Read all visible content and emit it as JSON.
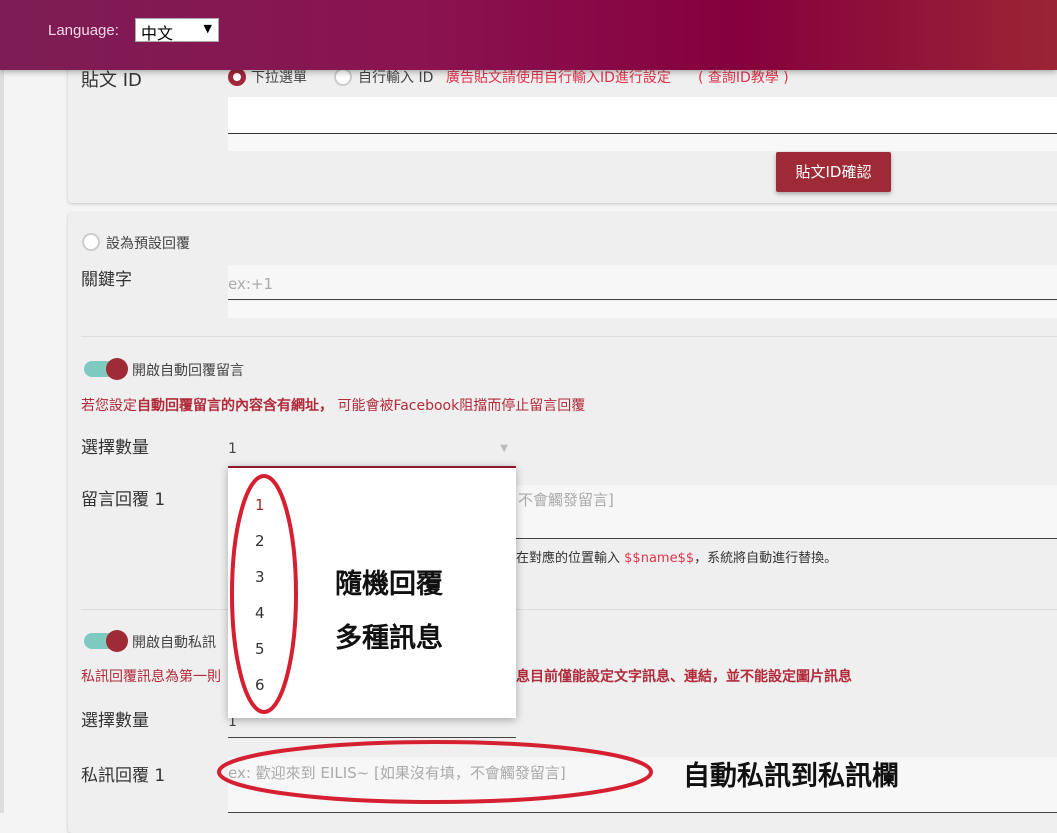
{
  "header": {
    "language_label": "Language:",
    "language_value": "中文"
  },
  "post_id": {
    "label": "貼文 ID",
    "radio_dropdown": "下拉選單",
    "radio_manual": "自行輸入 ID",
    "ad_note": "廣告貼文請使用自行輸入ID進行設定",
    "tutorial_link": "( 查詢ID教學 )",
    "confirm_button": "貼文ID確認"
  },
  "reply": {
    "default_radio": "設為預設回覆",
    "keyword_label": "關鍵字",
    "keyword_placeholder": "ex:+1",
    "comment_toggle": "開啟自動回覆留言",
    "warn_prefix": "若您設定",
    "warn_bold": "自動回覆留言的內容含有網址，",
    "warn_suffix": "可能會被Facebook阻擋而停止留言回覆",
    "count_label": "選擇數量",
    "count_value": "1",
    "comment_reply_label": "留言回覆 1",
    "comment_placeholder_visible": "不會觸發留言]",
    "name_hint_prefix": "在對應的位置輸入",
    "name_hint_token": "$$name$$",
    "name_hint_suffix": "，系統將自動進行替換。",
    "pm_toggle": "開啟自動私訊",
    "pm_note_prefix": "私訊回覆訊息為第一則",
    "pm_note_bold": "息目前僅能設定文字訊息、連結，並不能設定圖片訊息",
    "pm_count_label": "選擇數量",
    "pm_count_value": "1",
    "pm_reply_label": "私訊回覆 1",
    "pm_placeholder": "ex: 歡迎來到 EILIS~ [如果沒有填，不會觸發留言]"
  },
  "dropdown": {
    "options": [
      "1",
      "2",
      "3",
      "4",
      "5",
      "6"
    ],
    "selected": "1"
  },
  "annotations": {
    "random_line1": "隨機回覆",
    "random_line2": "多種訊息",
    "pm_to_inbox": "自動私訊到私訊欄"
  },
  "colors": {
    "accent": "#9e2a35",
    "header": "#85003d",
    "toggle_track": "#7fcac0",
    "annotation_circle": "#d42030"
  }
}
